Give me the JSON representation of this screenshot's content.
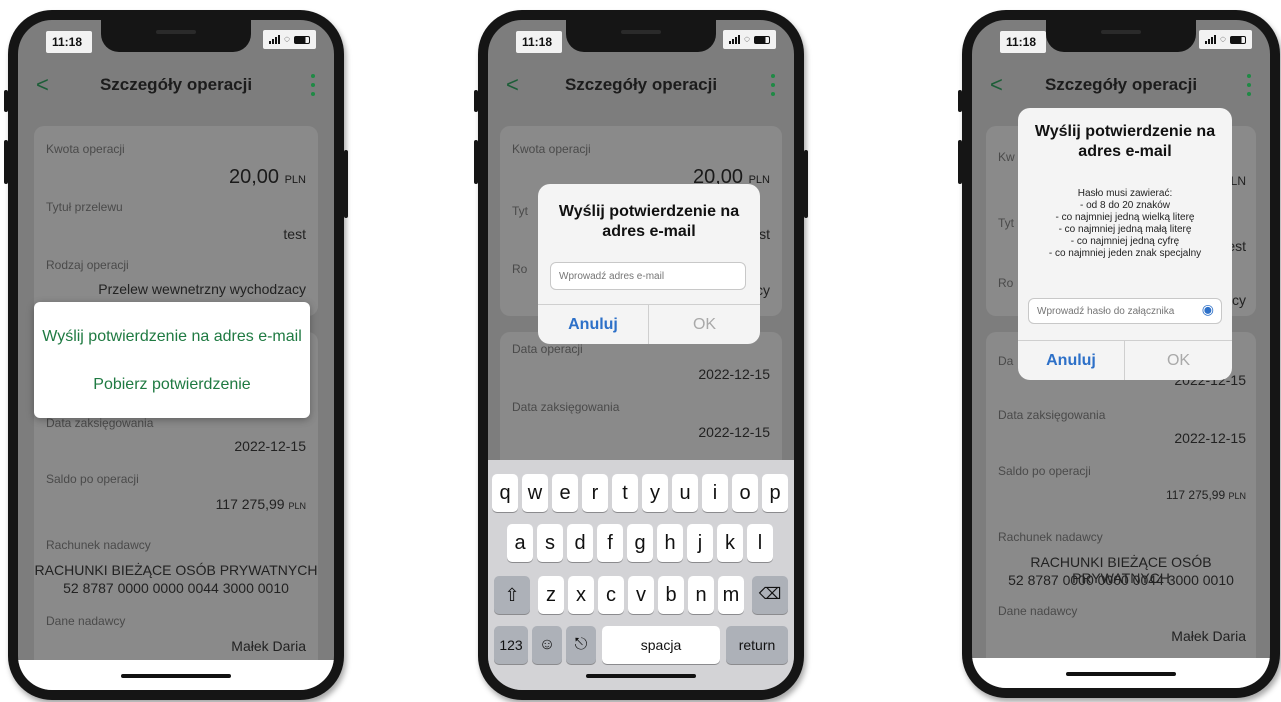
{
  "status": {
    "time": "11:18"
  },
  "header": {
    "title": "Szczegóły operacji",
    "back": "<"
  },
  "screen1": {
    "amount_label": "Kwota operacji",
    "amount_value": "20,00",
    "currency": "PLN",
    "title_label": "Tytuł przelewu",
    "title_value": "test",
    "type_label": "Rodzaj operacji",
    "type_value": "Przelew wewnetrzny wychodzacy",
    "sheet_option_email": "Wyślij potwierdzenie na adres e-mail",
    "sheet_option_download": "Pobierz potwierdzenie",
    "booking_label": "Data zaksięgowania",
    "booking_value": "2022-12-15",
    "balance_label": "Saldo po operacji",
    "balance_value": "117 275,99",
    "sender_account_label": "Rachunek nadawcy",
    "sender_account_name": "RACHUNKI BIEŻĄCE OSÓB PRYWATNYCH",
    "sender_account_number": "52 8787 0000 0000 0044 3000 0010",
    "sender_label": "Dane nadawcy",
    "sender_value": "Małek Daria"
  },
  "screen2": {
    "amount_label": "Kwota operacji",
    "amount_value": "20,00",
    "currency": "PLN",
    "partial_label_1": "Tyt",
    "partial_value_1": "est",
    "partial_label_2": "Ro",
    "partial_value_2": "ący",
    "dialog_title": "Wyślij potwierdzenie na adres e-mail",
    "email_placeholder": "Wprowadź adres e-mail",
    "cancel": "Anuluj",
    "ok": "OK",
    "date_label": "Data operacji",
    "date_value": "2022-12-15",
    "booking_label": "Data zaksięgowania",
    "booking_value": "2022-12-15",
    "keyboard": {
      "row1": [
        "q",
        "w",
        "e",
        "r",
        "t",
        "y",
        "u",
        "i",
        "o",
        "p"
      ],
      "row2": [
        "a",
        "s",
        "d",
        "f",
        "g",
        "h",
        "j",
        "k",
        "l"
      ],
      "row3": [
        "z",
        "x",
        "c",
        "v",
        "b",
        "n",
        "m"
      ],
      "numbers": "123",
      "space": "spacja",
      "return": "return"
    }
  },
  "screen3": {
    "partial_label_1": "Kw",
    "partial_value_1": "LN",
    "partial_label_2": "Tyt",
    "partial_value_2": "est",
    "partial_label_3": "Ro",
    "partial_value_3": "ący",
    "partial_label_4": "Da",
    "partial_value_4": "2022-12-15",
    "dialog_title": "Wyślij potwierdzenie na adres e-mail",
    "password_rules": [
      "Hasło musi zawierać:",
      "- od 8 do 20 znaków",
      "- co najmniej jedną wielką literę",
      "- co najmniej jedną małą literę",
      "- co najmniej jedną cyfrę",
      "- co najmniej jeden znak specjalny"
    ],
    "password_placeholder": "Wprowadź hasło do załącznika",
    "cancel": "Anuluj",
    "ok": "OK",
    "booking_label": "Data zaksięgowania",
    "booking_value": "2022-12-15",
    "balance_label": "Saldo po operacji",
    "balance_value": "117 275,99",
    "currency": "PLN",
    "sender_account_label": "Rachunek nadawcy",
    "sender_account_name": "RACHUNKI BIEŻĄCE OSÓB PRYWATNYCH",
    "sender_account_number": "52 8787 0000 0000 0044 3000 0010",
    "sender_label": "Dane nadawcy",
    "sender_value": "Małek Daria"
  },
  "colors": {
    "accent_green": "#1f7a42",
    "ios_blue": "#2d70c8",
    "overlay": "#7d7d7d"
  },
  "icons": [
    "chevron-left-icon",
    "more-vertical-icon",
    "eye-icon",
    "shift-icon",
    "backspace-icon",
    "emoji-icon",
    "microphone-icon",
    "battery-icon",
    "wifi-icon",
    "signal-icon"
  ]
}
